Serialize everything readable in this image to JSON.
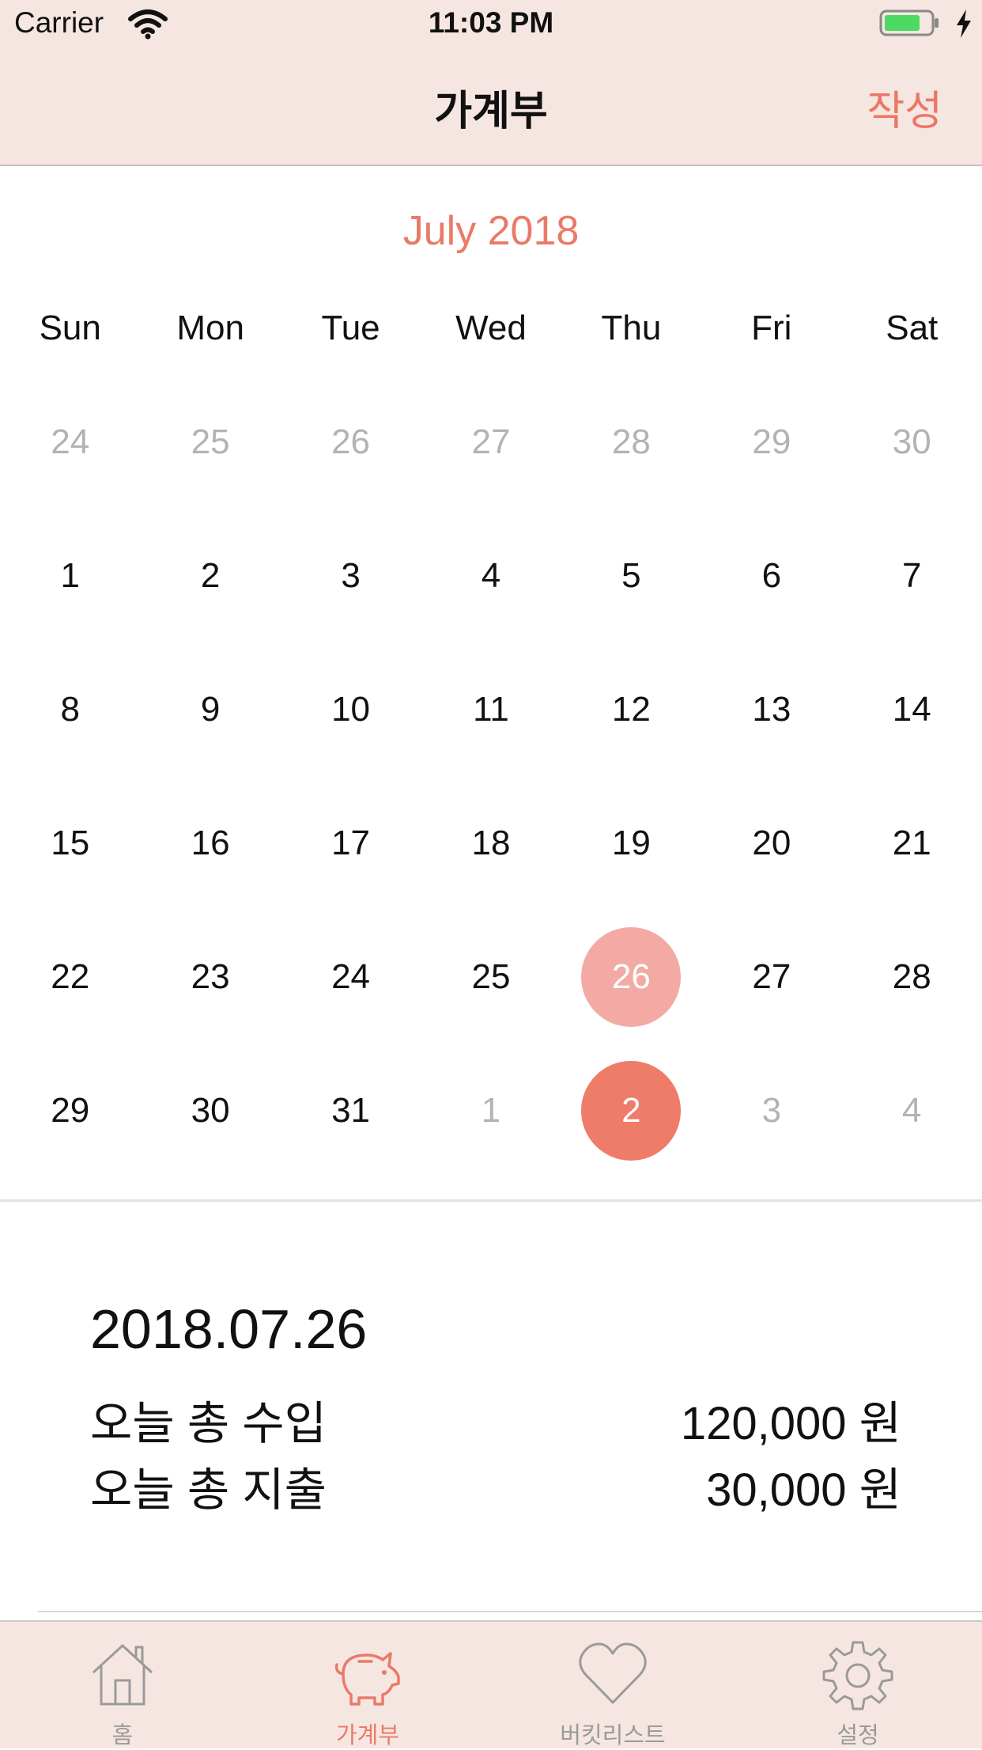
{
  "status_bar": {
    "carrier": "Carrier",
    "time": "11:03 PM"
  },
  "nav": {
    "title": "가계부",
    "action_label": "작성"
  },
  "calendar": {
    "month_title": "July 2018",
    "weekdays": [
      "Sun",
      "Mon",
      "Tue",
      "Wed",
      "Thu",
      "Fri",
      "Sat"
    ],
    "weeks": [
      [
        {
          "d": "24",
          "m": true
        },
        {
          "d": "25",
          "m": true
        },
        {
          "d": "26",
          "m": true
        },
        {
          "d": "27",
          "m": true
        },
        {
          "d": "28",
          "m": true
        },
        {
          "d": "29",
          "m": true
        },
        {
          "d": "30",
          "m": true
        }
      ],
      [
        {
          "d": "1"
        },
        {
          "d": "2"
        },
        {
          "d": "3"
        },
        {
          "d": "4"
        },
        {
          "d": "5"
        },
        {
          "d": "6"
        },
        {
          "d": "7"
        }
      ],
      [
        {
          "d": "8"
        },
        {
          "d": "9"
        },
        {
          "d": "10"
        },
        {
          "d": "11"
        },
        {
          "d": "12"
        },
        {
          "d": "13"
        },
        {
          "d": "14"
        }
      ],
      [
        {
          "d": "15"
        },
        {
          "d": "16"
        },
        {
          "d": "17"
        },
        {
          "d": "18"
        },
        {
          "d": "19"
        },
        {
          "d": "20"
        },
        {
          "d": "21"
        }
      ],
      [
        {
          "d": "22"
        },
        {
          "d": "23"
        },
        {
          "d": "24"
        },
        {
          "d": "25"
        },
        {
          "d": "26",
          "s": "selected"
        },
        {
          "d": "27"
        },
        {
          "d": "28"
        }
      ],
      [
        {
          "d": "29"
        },
        {
          "d": "30"
        },
        {
          "d": "31"
        },
        {
          "d": "1",
          "m": true
        },
        {
          "d": "2",
          "s": "today"
        },
        {
          "d": "3",
          "m": true
        },
        {
          "d": "4",
          "m": true
        }
      ]
    ],
    "selected_color": "#f3aaa4",
    "today_color": "#ef7b69"
  },
  "summary": {
    "date": "2018.07.26",
    "income_label": "오늘 총 수입",
    "income_value": "120,000 원",
    "expense_label": "오늘 총 지출",
    "expense_value": "30,000 원"
  },
  "tabs": [
    {
      "label": "홈",
      "icon": "house-icon",
      "active": false
    },
    {
      "label": "가계부",
      "icon": "piggy-bank-icon",
      "active": true
    },
    {
      "label": "버킷리스트",
      "icon": "heart-icon",
      "active": false
    },
    {
      "label": "설정",
      "icon": "gear-icon",
      "active": false
    }
  ],
  "colors": {
    "accent": "#ea7a68",
    "bar_background": "#f6e6e1"
  }
}
